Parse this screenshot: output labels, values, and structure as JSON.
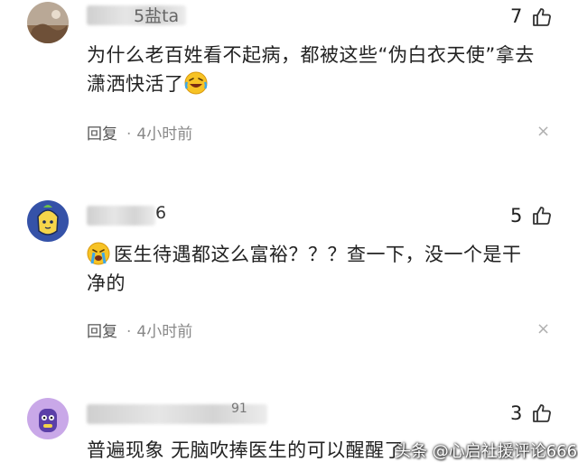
{
  "comments": [
    {
      "username_visible": "5盐ta",
      "likes": "7",
      "text_pre": "为什么老百姓看不起病，都被这些“伪白衣天使”拿去潇洒快活了",
      "emoji_name": "laughing-crying-emoji",
      "reply_label": "回复",
      "time": "4小时前",
      "close_icon": "close-icon"
    },
    {
      "username_visible": "6",
      "likes": "5",
      "emoji_name": "crying-emoji",
      "text_post": "医生待遇都这么富裕？？？查一下，没一个是干净的",
      "reply_label": "回复",
      "time": "4小时前",
      "close_icon": "close-icon"
    },
    {
      "username_visible": "91",
      "likes": "3",
      "text_post": "普遍现象 无脑吹捧医生的可以醒醒了"
    }
  ],
  "watermark": "头条 @心启社援评论666",
  "colors": {
    "text": "#222222",
    "meta": "#888888",
    "icon": "#333333"
  }
}
